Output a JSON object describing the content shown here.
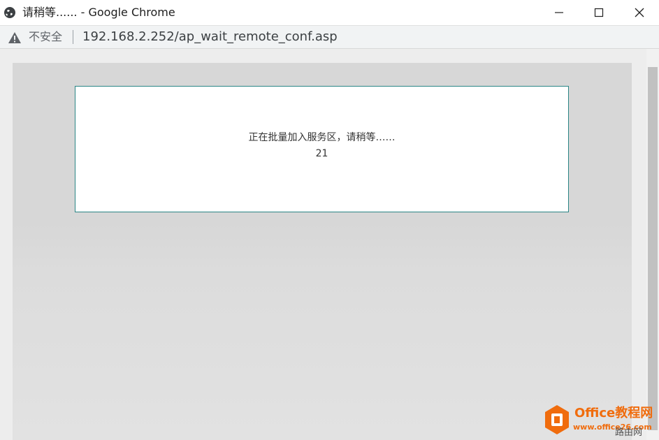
{
  "window": {
    "title": "请稍等...... - Google Chrome",
    "minimize_glyph": "—",
    "maximize_glyph": "☐",
    "close_glyph": "✕"
  },
  "addressbar": {
    "security_icon": "warning-triangle-icon",
    "security_label": "不安全",
    "url": "192.168.2.252/ap_wait_remote_conf.asp"
  },
  "dialog": {
    "message": "正在批量加入服务区，请稍等……",
    "count": "21"
  },
  "watermark": {
    "title": "Office教程网",
    "url": "www.office26.com",
    "corner_text": "路由网"
  },
  "colors": {
    "dialog_border": "#2a8585",
    "watermark_orange": "#f06c0d"
  }
}
